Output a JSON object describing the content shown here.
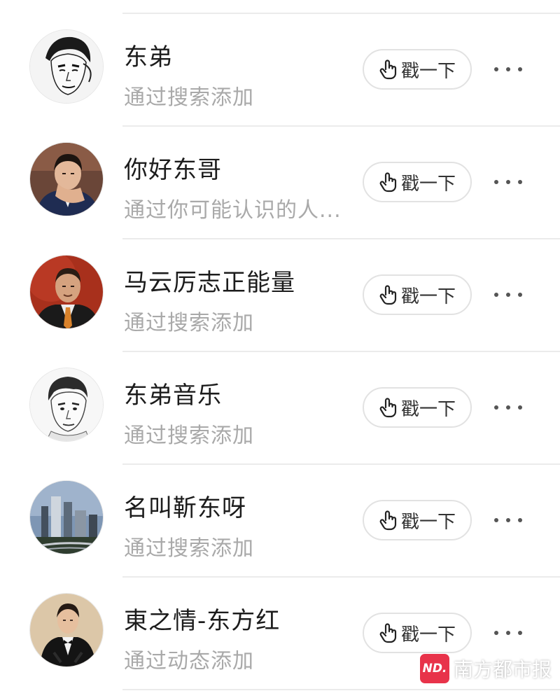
{
  "contacts": [
    {
      "name": "东弟",
      "source": "通过搜索添加",
      "poke_label": "戳一下",
      "avatar": "sketch-portrait-man"
    },
    {
      "name": "你好东哥",
      "source": "通过你可能认识的人...",
      "poke_label": "戳一下",
      "avatar": "photo-man-suit-thinking"
    },
    {
      "name": "马云厉志正能量",
      "source": "通过搜索添加",
      "poke_label": "戳一下",
      "avatar": "photo-man-suit-red-background"
    },
    {
      "name": "东弟音乐",
      "source": "通过搜索添加",
      "poke_label": "戳一下",
      "avatar": "sketch-portrait-man"
    },
    {
      "name": "名叫靳东呀",
      "source": "通过搜索添加",
      "poke_label": "戳一下",
      "avatar": "photo-city-skyline"
    },
    {
      "name": "東之情-东方红",
      "source": "通过动态添加",
      "poke_label": "戳一下",
      "avatar": "photo-man-tuxedo"
    }
  ],
  "icons": {
    "poke": "hand-pointer-icon",
    "more": "more-dots-icon"
  },
  "watermark": {
    "logo_text": "ND.",
    "text": "南方都市报"
  },
  "colors": {
    "name": "#1c1c1c",
    "source": "#a9a9a9",
    "divider": "#ebebeb",
    "brand": "#e8334a"
  }
}
